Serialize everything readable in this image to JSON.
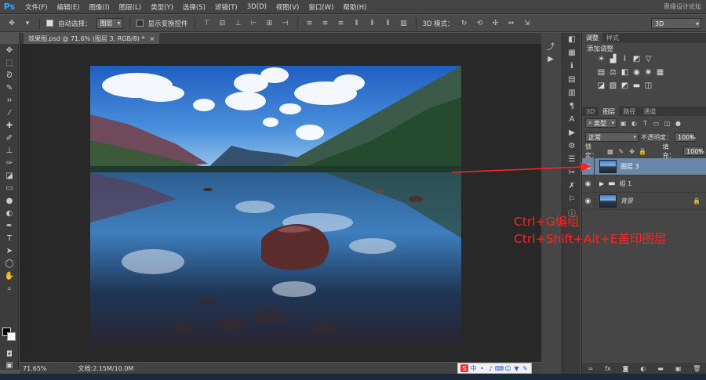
{
  "menu": {
    "logo": "Ps",
    "items": [
      "文件(F)",
      "编辑(E)",
      "图像(I)",
      "图层(L)",
      "类型(Y)",
      "选择(S)",
      "滤镜(T)",
      "3D(D)",
      "视图(V)",
      "窗口(W)",
      "帮助(H)"
    ],
    "watermark": "思缘设计论坛"
  },
  "options": {
    "auto_select_label": "自动选择：",
    "auto_select_value": "图层",
    "show_transform_label": "显示变换控件",
    "mode_3d_label": "3D 模式：",
    "workspace_value": "3D"
  },
  "document": {
    "tab_title": "效果图.psd @ 71.6% (图层 3, RGB/8) *",
    "close_glyph": "×"
  },
  "status": {
    "zoom": "71.65%",
    "doc_size": "文档:2.15M/10.0M"
  },
  "ime": {
    "logo": "S",
    "lang": "中"
  },
  "panels": {
    "adjust_tabs": [
      "调整",
      "样式"
    ],
    "adjust_title": "添加调整",
    "layers_tabs": [
      "3D",
      "图层",
      "路径",
      "通道"
    ],
    "filter_kind": "类型",
    "blend_mode": "正常",
    "opacity_label": "不透明度：",
    "opacity_value": "100%",
    "lock_label": "锁定：",
    "fill_label": "填充：",
    "fill_value": "100%",
    "layers": [
      {
        "name": "图层 3",
        "kind": "pixel",
        "selected": true
      },
      {
        "name": "组 1",
        "kind": "group",
        "selected": false
      },
      {
        "name": "背景",
        "kind": "background",
        "selected": false
      }
    ],
    "footer_icons": [
      "link-icon",
      "fx-icon",
      "mask-icon",
      "adjustment-icon",
      "folder-icon",
      "new-layer-icon",
      "trash-icon"
    ]
  },
  "annotation": {
    "line1": "Ctrl+G编组",
    "line2": "Ctrl+Shift+Alt+E盖印图层",
    "color": "#ff2323"
  },
  "colors": {
    "selected_layer": "#6a86a8",
    "ps_blue": "#31a8ff"
  }
}
